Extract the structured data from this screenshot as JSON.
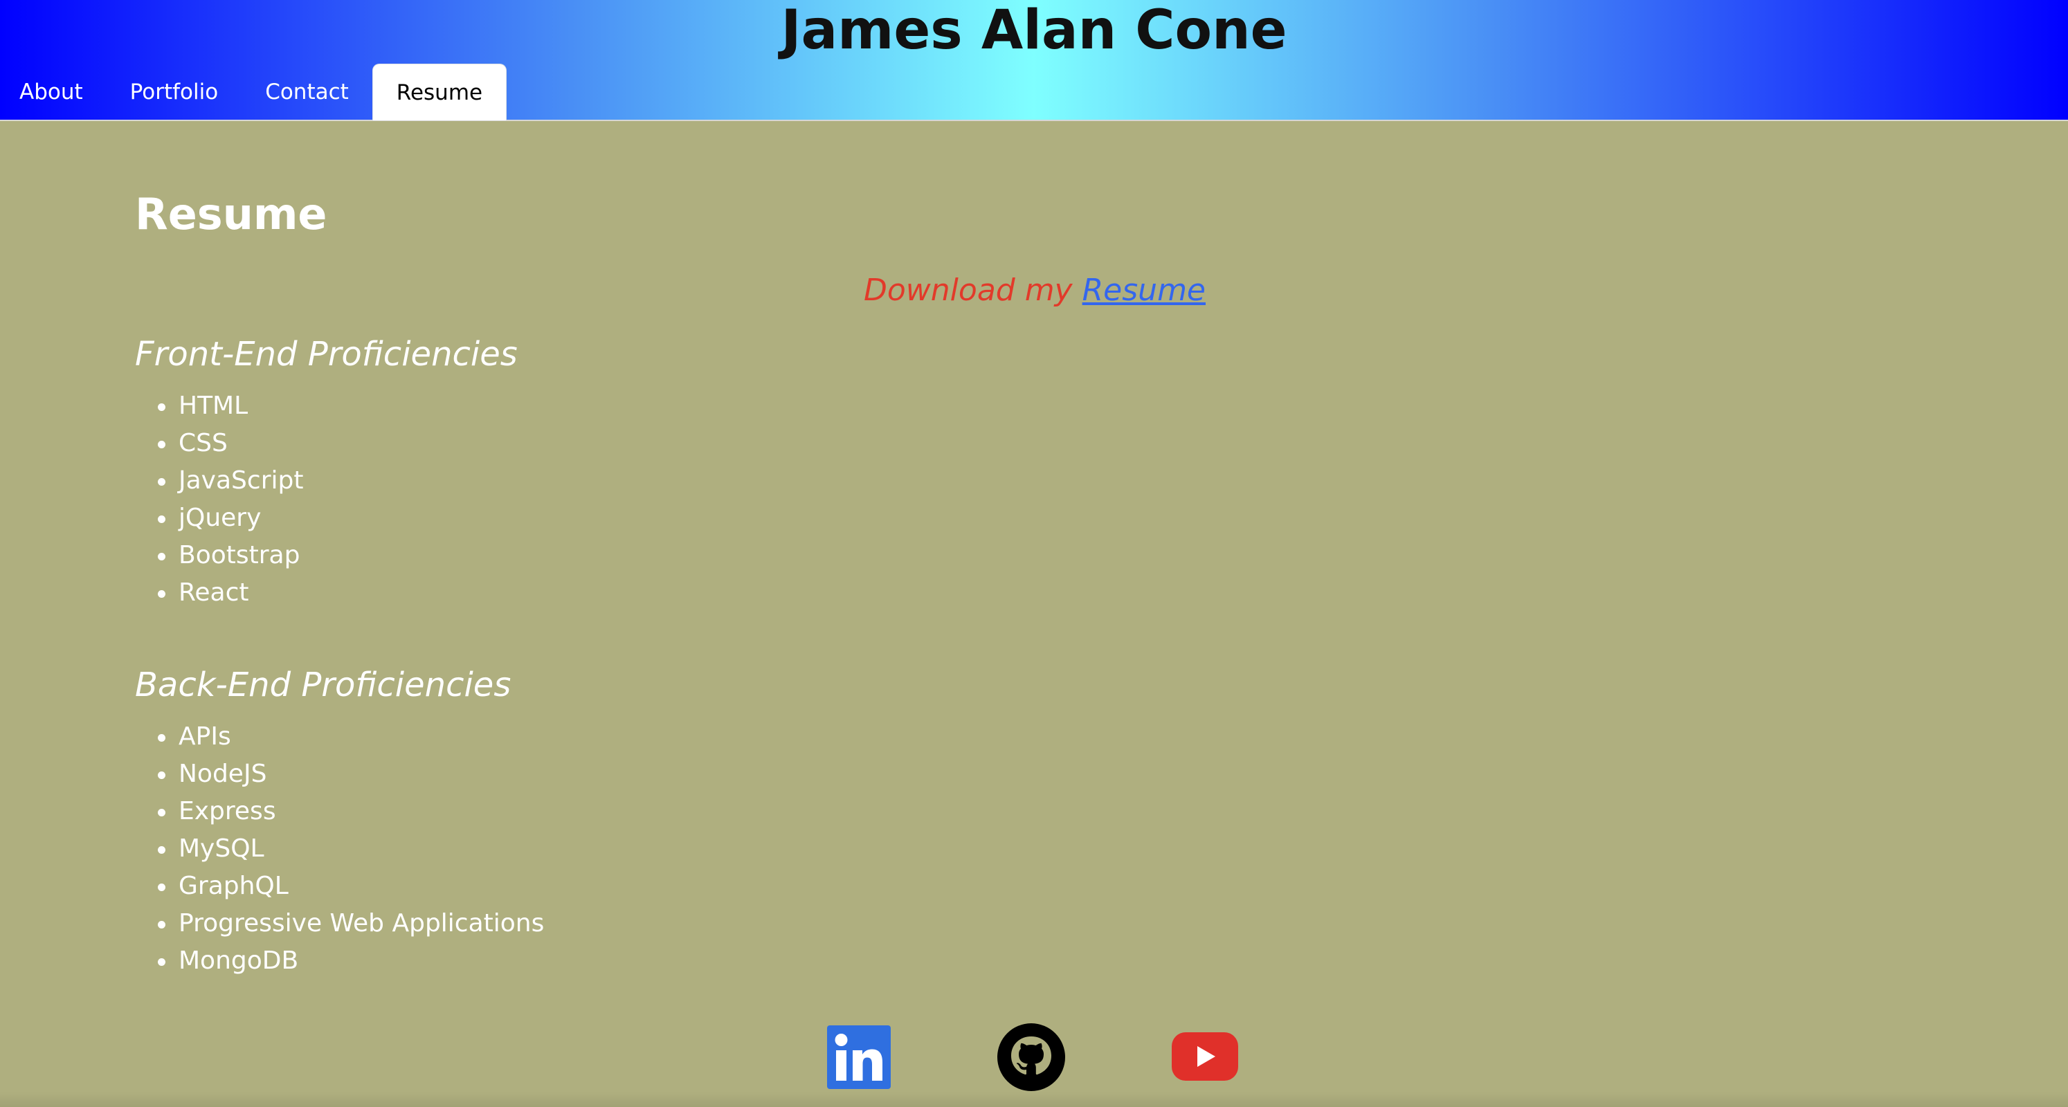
{
  "header": {
    "title": "James Alan Cone",
    "tabs": [
      {
        "label": "About"
      },
      {
        "label": "Portfolio"
      },
      {
        "label": "Contact"
      },
      {
        "label": "Resume",
        "active": true
      }
    ]
  },
  "main": {
    "heading": "Resume",
    "download_prefix": "Download my",
    "download_link": "Resume",
    "frontend": {
      "heading": "Front-End Proficiencies",
      "items": [
        "HTML",
        "CSS",
        "JavaScript",
        "jQuery",
        "Bootstrap",
        "React"
      ]
    },
    "backend": {
      "heading": "Back-End Proficiencies",
      "items": [
        "APIs",
        "NodeJS",
        "Express",
        "MySQL",
        "GraphQL",
        "Progressive Web Applications",
        "MongoDB"
      ]
    }
  },
  "footer": {
    "icons": [
      {
        "name": "linkedin-icon",
        "color": "#2f6fe0"
      },
      {
        "name": "github-icon",
        "color": "#000000"
      },
      {
        "name": "youtube-icon",
        "color": "#e0302a"
      }
    ]
  },
  "colors": {
    "page_background": "#afaf7f",
    "download_text": "#e23a2a",
    "link": "#3366ee",
    "header_gradient_edge": "#0000ff",
    "header_gradient_center": "#7fffff"
  }
}
